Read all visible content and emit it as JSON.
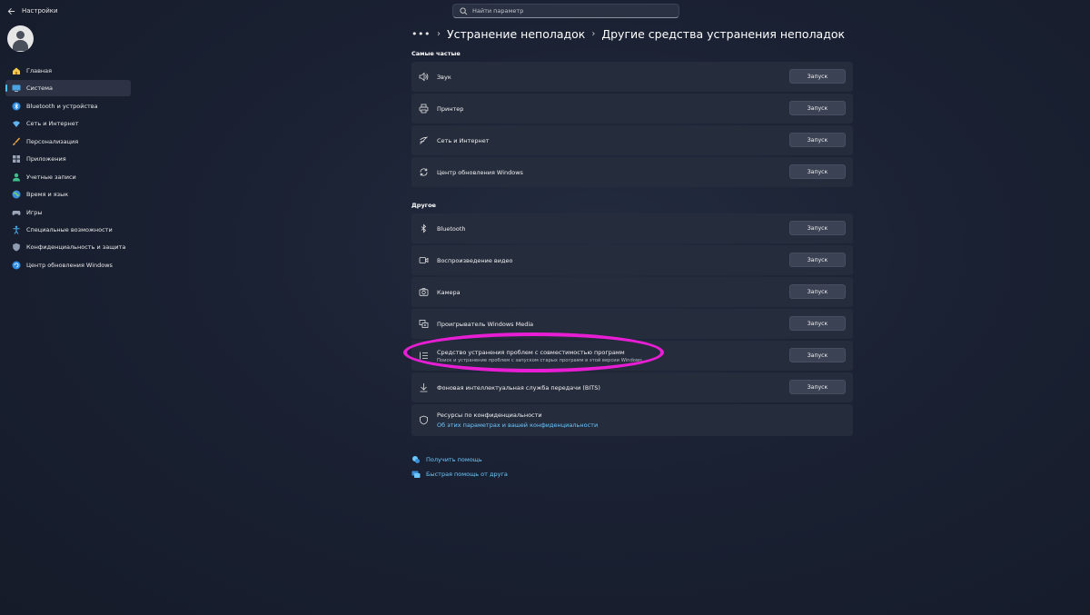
{
  "app": {
    "title": "Настройки",
    "back_icon": "arrow-left-icon"
  },
  "search": {
    "placeholder": "Найти параметр"
  },
  "sidebar": {
    "items": [
      {
        "label": "Главная",
        "icon": "home-icon",
        "active": false
      },
      {
        "label": "Система",
        "icon": "monitor-icon",
        "active": true
      },
      {
        "label": "Bluetooth и устройства",
        "icon": "bluetooth-icon",
        "active": false
      },
      {
        "label": "Сеть и Интернет",
        "icon": "wifi-icon",
        "active": false
      },
      {
        "label": "Персонализация",
        "icon": "brush-icon",
        "active": false
      },
      {
        "label": "Приложения",
        "icon": "apps-icon",
        "active": false
      },
      {
        "label": "Учетные записи",
        "icon": "user-icon",
        "active": false
      },
      {
        "label": "Время и язык",
        "icon": "globe-icon",
        "active": false
      },
      {
        "label": "Игры",
        "icon": "gamepad-icon",
        "active": false
      },
      {
        "label": "Специальные возможности",
        "icon": "accessibility-icon",
        "active": false
      },
      {
        "label": "Конфиденциальность и защита",
        "icon": "shield-icon",
        "active": false
      },
      {
        "label": "Центр обновления Windows",
        "icon": "update-icon",
        "active": false
      }
    ]
  },
  "breadcrumb": {
    "dots": "•••",
    "parent": "Устранение неполадок",
    "current": "Другие средства устранения неполадок"
  },
  "sections": {
    "frequent": {
      "title": "Самые частые",
      "items": [
        {
          "label": "Звук",
          "icon": "speaker-icon",
          "button": "Запуск"
        },
        {
          "label": "Принтер",
          "icon": "printer-icon",
          "button": "Запуск"
        },
        {
          "label": "Сеть и Интернет",
          "icon": "network-icon",
          "button": "Запуск"
        },
        {
          "label": "Центр обновления Windows",
          "icon": "refresh-icon",
          "button": "Запуск"
        }
      ]
    },
    "other": {
      "title": "Другое",
      "items": [
        {
          "label": "Bluetooth",
          "icon": "bluetooth-icon",
          "button": "Запуск"
        },
        {
          "label": "Воспроизведение видео",
          "icon": "video-icon",
          "button": "Запуск"
        },
        {
          "label": "Камера",
          "icon": "camera-icon",
          "button": "Запуск"
        },
        {
          "label": "Проигрыватель Windows Media",
          "icon": "media-player-icon",
          "button": "Запуск"
        },
        {
          "label": "Средство устранения проблем с совместимостью программ",
          "description": "Поиск и устранение проблем с запуском старых программ в этой версии Windows.",
          "icon": "list-icon",
          "button": "Запуск"
        },
        {
          "label": "Фоновая интеллектуальная служба передачи (BITS)",
          "icon": "download-icon",
          "button": "Запуск"
        }
      ]
    },
    "privacy": {
      "label": "Ресурсы по конфиденциальности",
      "link": "Об этих параметрах и вашей конфиденциальности",
      "icon": "shield-outline-icon"
    }
  },
  "help": {
    "get_help": "Получить помощь",
    "quick_assist": "Быстрая помощь от друга"
  },
  "colors": {
    "accent": "#4cc2ff",
    "link": "#6cc6ff",
    "highlight": "#e81ed4",
    "card": "#252c3c"
  }
}
